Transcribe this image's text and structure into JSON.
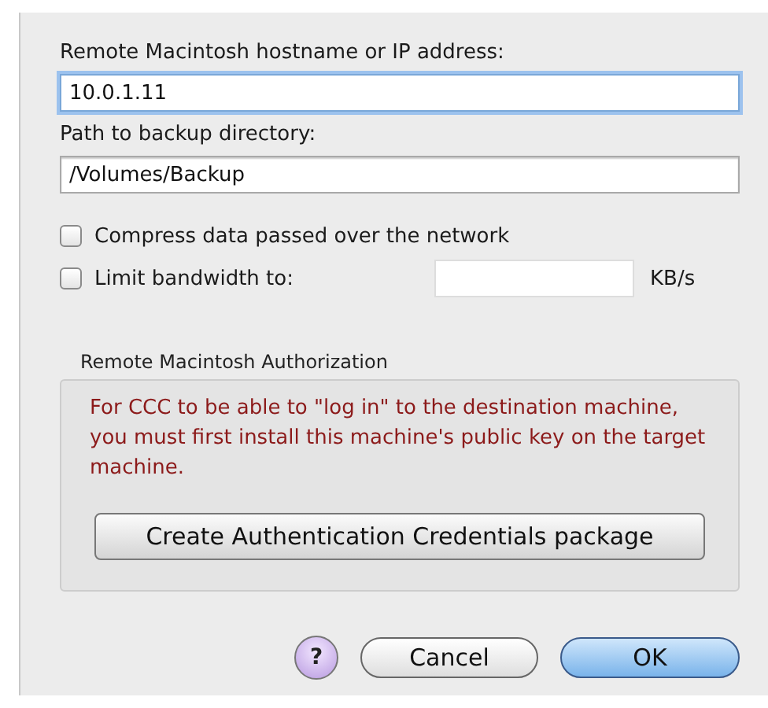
{
  "hostname": {
    "label": "Remote Macintosh hostname or IP address:",
    "value": "10.0.1.11",
    "focused": true
  },
  "path": {
    "label": "Path to backup directory:",
    "value": "/Volumes/Backup",
    "focused": false
  },
  "options": [
    {
      "kind": "checkbox",
      "label": "Compress data passed over the network",
      "checked": false
    },
    {
      "kind": "checkbox-field",
      "label": "Limit bandwidth to:",
      "checked": false,
      "unit": "KB/s"
    }
  ],
  "authorization": {
    "title": "Remote Macintosh Authorization",
    "message": "For CCC to be able to \"log in\" to the destination machine, you must first install this machine's public key on the target machine.",
    "button": "Create Authentication Credentials package"
  },
  "help": "?",
  "buttons": [
    {
      "label": "Cancel",
      "default": false
    },
    {
      "label": "OK",
      "default": true
    }
  ]
}
